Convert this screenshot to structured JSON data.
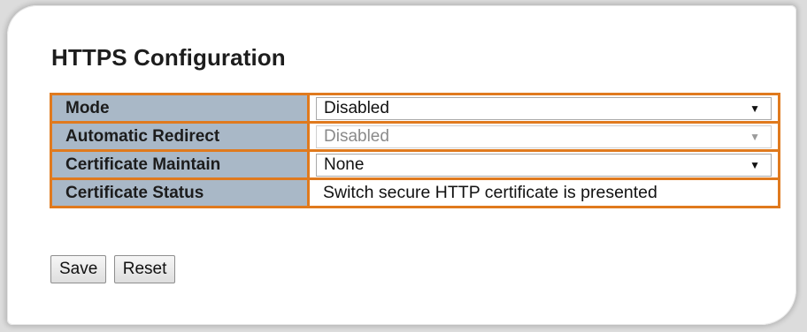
{
  "page": {
    "title": "HTTPS Configuration"
  },
  "config": {
    "rows": [
      {
        "label": "Mode",
        "type": "select",
        "value": "Disabled",
        "disabled": false
      },
      {
        "label": "Automatic Redirect",
        "type": "select",
        "value": "Disabled",
        "disabled": true
      },
      {
        "label": "Certificate Maintain",
        "type": "select",
        "value": "None",
        "disabled": false
      },
      {
        "label": "Certificate Status",
        "type": "text",
        "value": "Switch secure HTTP certificate is presented"
      }
    ]
  },
  "buttons": {
    "save_label": "Save",
    "reset_label": "Reset"
  },
  "icons": {
    "dropdown_arrow": "▼"
  },
  "colors": {
    "table_border": "#e07a1e",
    "label_background": "#a9b8c7"
  }
}
